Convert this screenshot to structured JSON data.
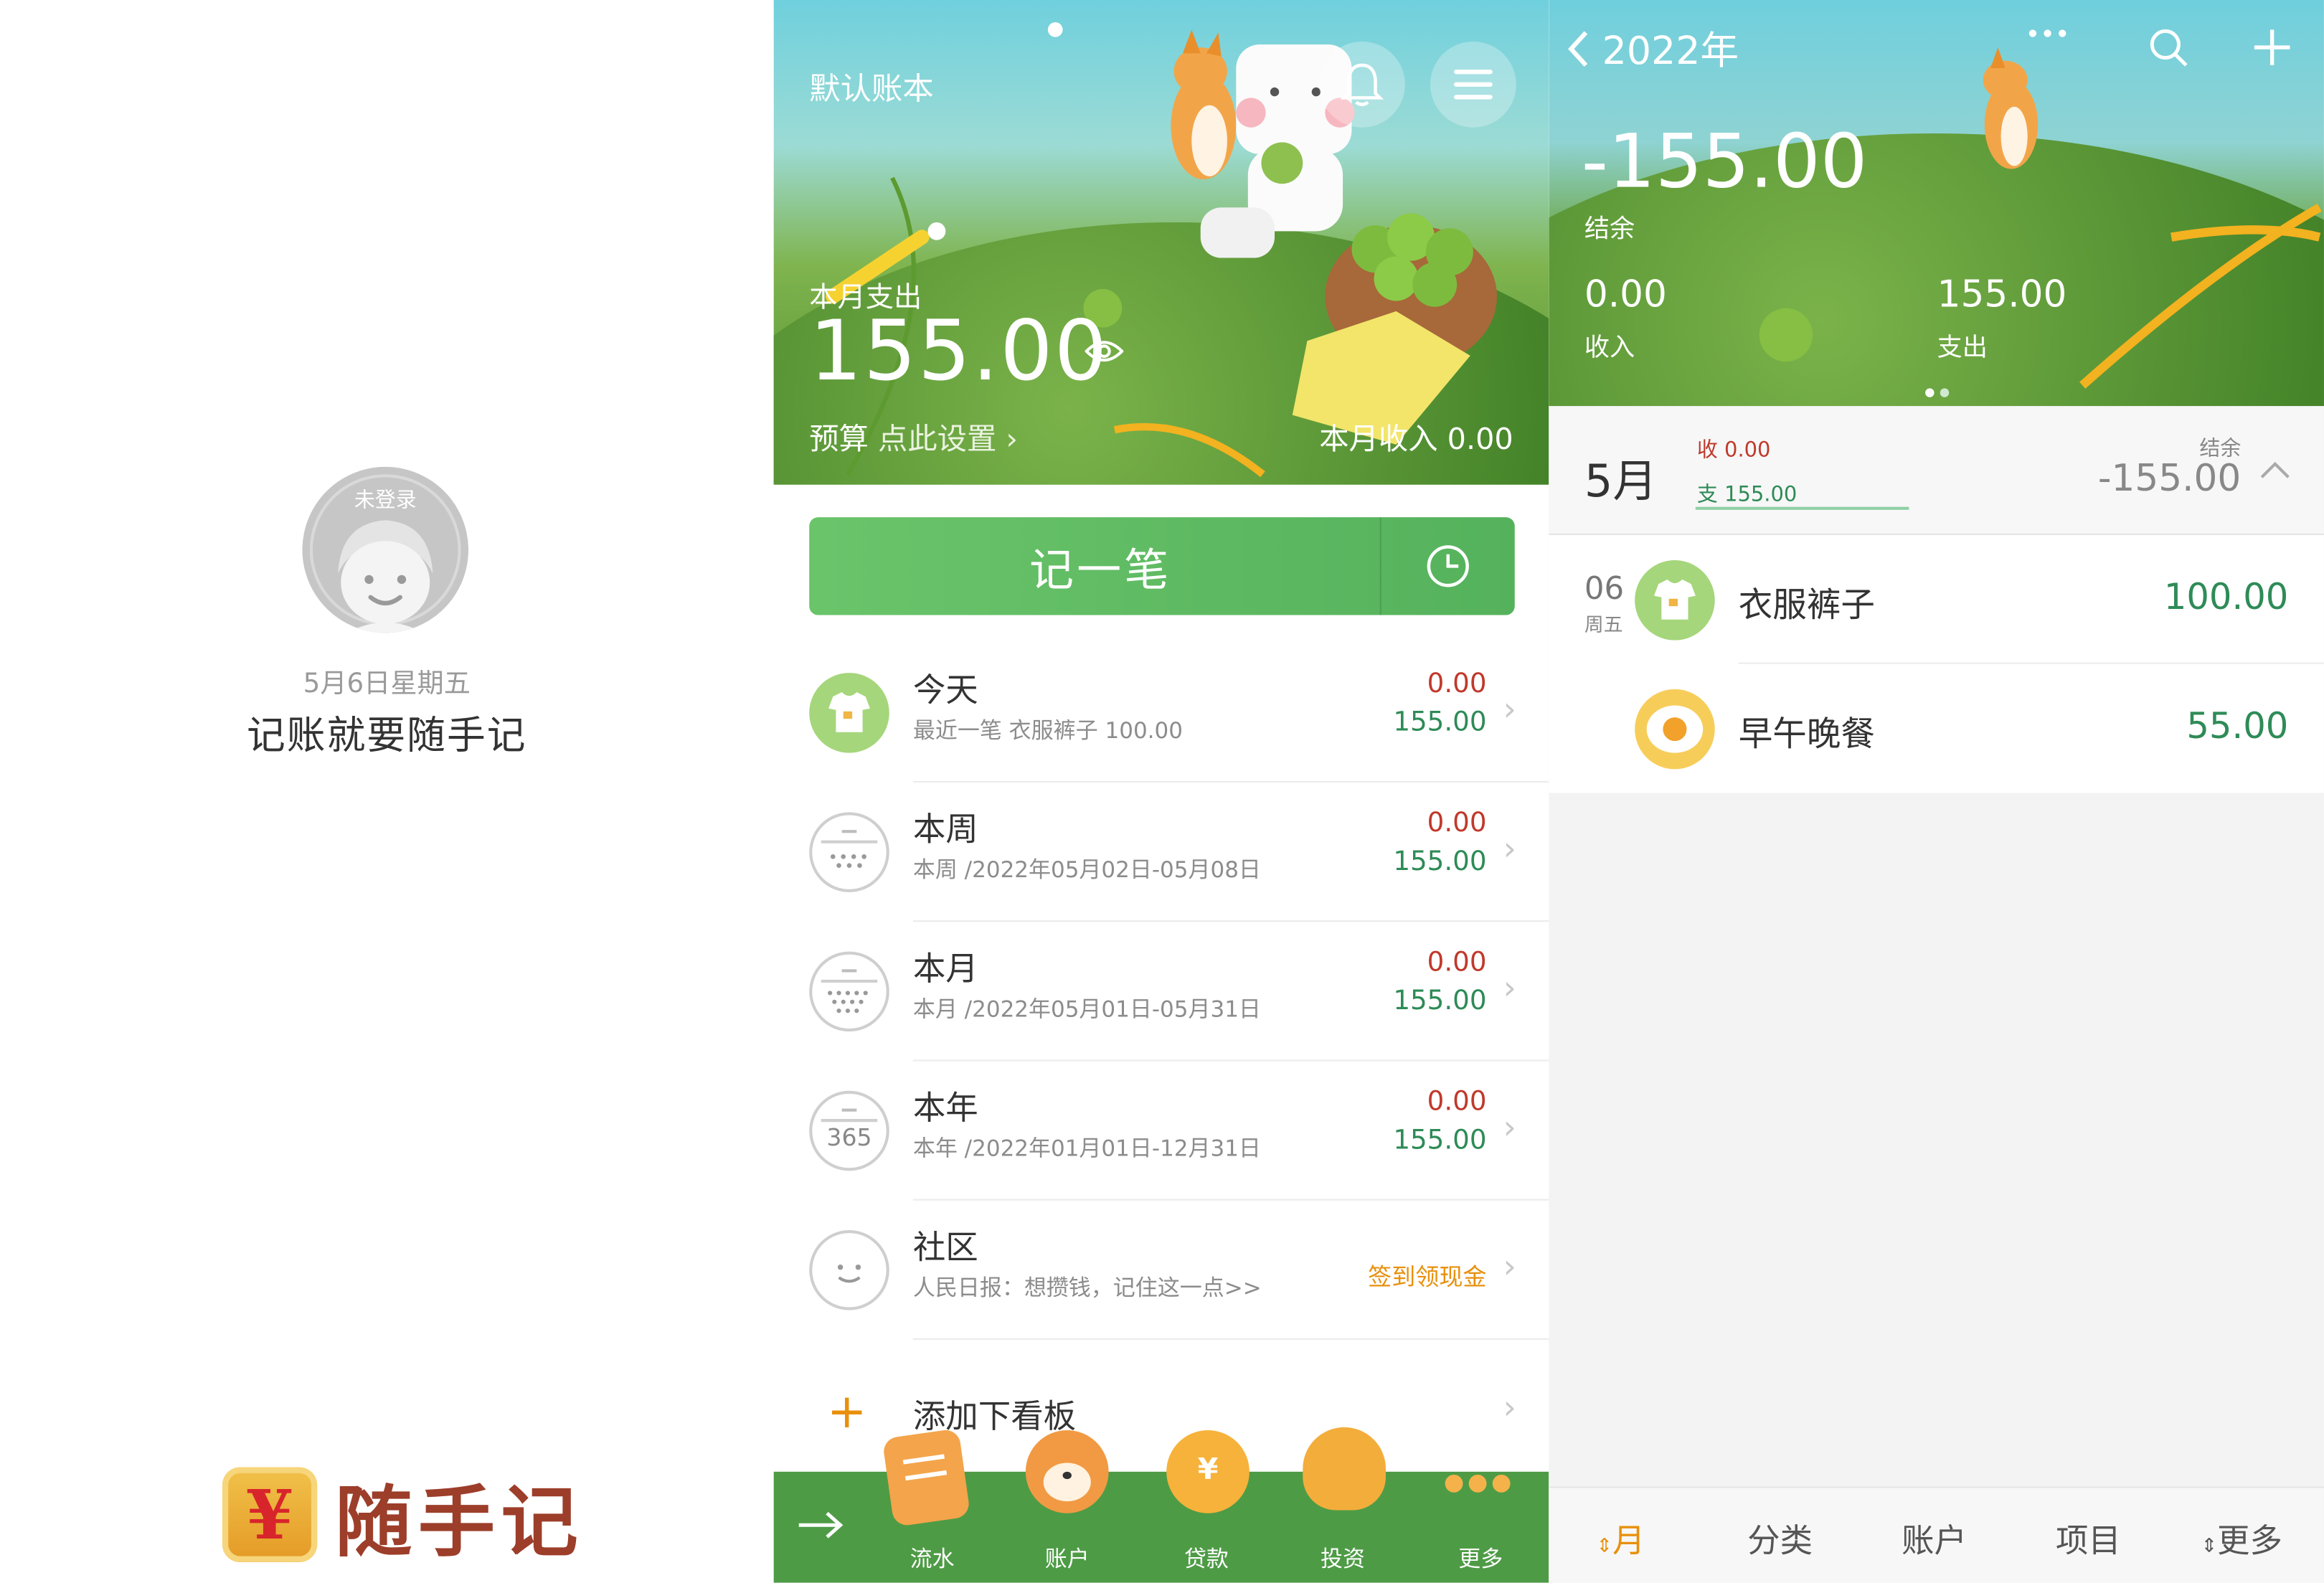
{
  "panel_login": {
    "avatar_badge": "未登录",
    "date": "5月6日星期五",
    "slogan": "记账就要随手记",
    "logo_mark": "¥",
    "logo_text": "随手记"
  },
  "panel_home": {
    "book_title": "默认账本",
    "month_expense_label": "本月支出",
    "month_expense": "155.00",
    "budget_label": "预算",
    "budget_action": "点此设置",
    "month_income": "本月收入 0.00",
    "record_button": "记一笔",
    "rows": [
      {
        "title": "今天",
        "subtitle": "最近一笔 衣服裤子 100.00",
        "income": "0.00",
        "expense": "155.00",
        "icon": "tshirt-icon"
      },
      {
        "title": "本周",
        "subtitle": "本周 /2022年05月02日-05月08日",
        "income": "0.00",
        "expense": "155.00",
        "icon": "calendar-week-icon"
      },
      {
        "title": "本月",
        "subtitle": "本月 /2022年05月01日-05月31日",
        "income": "0.00",
        "expense": "155.00",
        "icon": "calendar-month-icon"
      },
      {
        "title": "本年",
        "subtitle": "本年 /2022年01月01日-12月31日",
        "income": "0.00",
        "expense": "155.00",
        "icon": "calendar-year-icon",
        "icon_text": "365"
      },
      {
        "title": "社区",
        "subtitle": "人民日报：想攒钱，记住这一点>>",
        "action": "签到领现金",
        "icon": "chat-bubble-icon"
      }
    ],
    "add_board": "添加下看板",
    "nav": [
      {
        "label": "流水",
        "icon": "scroll-icon"
      },
      {
        "label": "账户",
        "icon": "shiba-icon"
      },
      {
        "label": "贷款",
        "icon": "trophy-icon"
      },
      {
        "label": "投资",
        "icon": "wheat-icon"
      },
      {
        "label": "更多",
        "icon": "dots-icon"
      }
    ],
    "colors": {
      "income": "#c0392b",
      "expense": "#2e8b57",
      "nav_bg": "#4e9b46",
      "action": "#e8900c"
    }
  },
  "panel_year": {
    "title": "2022年",
    "balance": "-155.00",
    "balance_label": "结余",
    "income": "0.00",
    "income_label": "收入",
    "expense": "155.00",
    "expense_label": "支出",
    "month": "5月",
    "month_income": "收 0.00",
    "month_expense": "支 155.00",
    "month_balance_label": "结余",
    "month_balance": "-155.00",
    "day": "06",
    "weekday": "周五",
    "entries": [
      {
        "name": "衣服裤子",
        "amount": "100.00",
        "icon": "tshirt-icon"
      },
      {
        "name": "早午晚餐",
        "amount": "55.00",
        "icon": "fried-egg-icon"
      }
    ],
    "tabs": [
      "月",
      "分类",
      "账户",
      "项目",
      "更多"
    ]
  }
}
